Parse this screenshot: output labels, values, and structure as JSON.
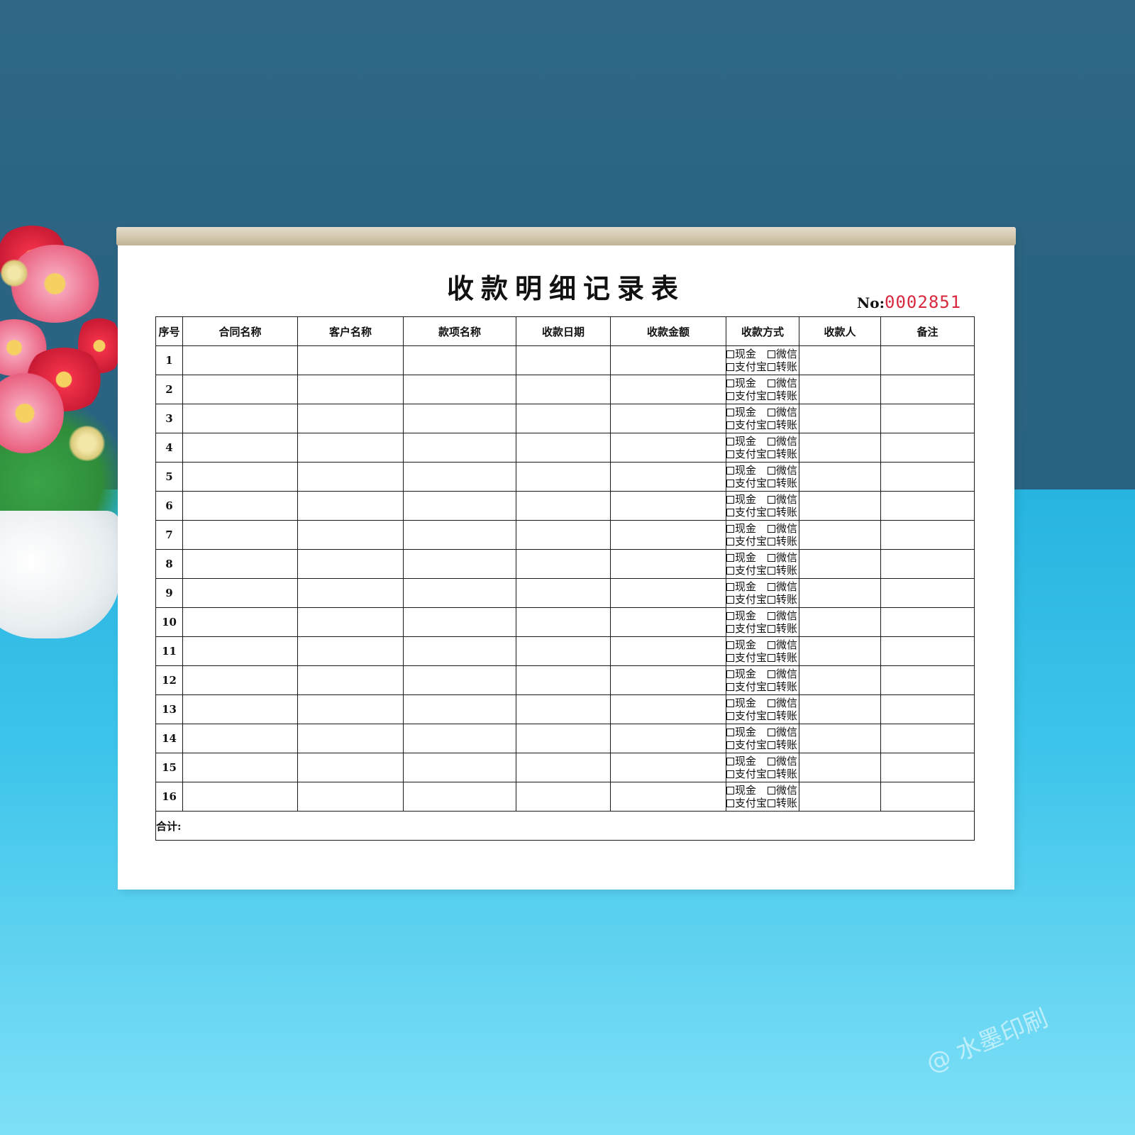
{
  "form": {
    "title": "收款明细记录表",
    "serial_label": "No:",
    "serial_number": "0002851",
    "serial_color": "#d8283e",
    "columns": [
      "序号",
      "合同名称",
      "客户名称",
      "款项名称",
      "收款日期",
      "收款金额",
      "收款方式",
      "收款人",
      "备注"
    ],
    "rows": [
      {
        "no": "1"
      },
      {
        "no": "2"
      },
      {
        "no": "3"
      },
      {
        "no": "4"
      },
      {
        "no": "5"
      },
      {
        "no": "6"
      },
      {
        "no": "7"
      },
      {
        "no": "8"
      },
      {
        "no": "9"
      },
      {
        "no": "10"
      },
      {
        "no": "11"
      },
      {
        "no": "12"
      },
      {
        "no": "13"
      },
      {
        "no": "14"
      },
      {
        "no": "15"
      },
      {
        "no": "16"
      }
    ],
    "payment_options": [
      "现金",
      "微信",
      "支付宝",
      "转账"
    ],
    "total_label": "合计:"
  },
  "watermark": "@ 水墨印刷",
  "colors": {
    "wall": "#2f6686",
    "desk": "#27b4e0",
    "binding": "#d3c7ad"
  }
}
